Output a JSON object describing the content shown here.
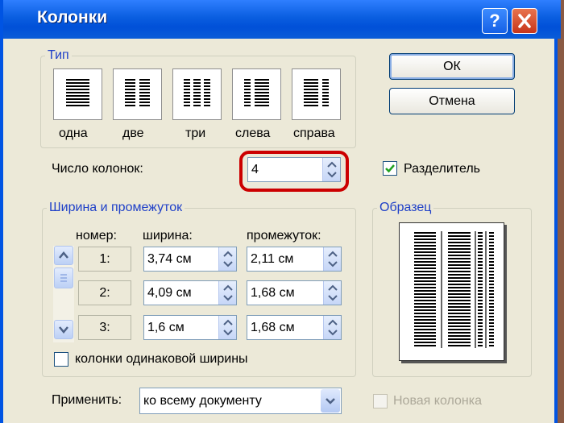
{
  "window": {
    "title": "Колонки",
    "help_symbol": "?",
    "close_symbol": "✕"
  },
  "type_group": {
    "legend": "Тип",
    "presets": [
      {
        "label": "одна",
        "icon": "one-column-icon"
      },
      {
        "label": "две",
        "icon": "two-columns-icon"
      },
      {
        "label": "три",
        "icon": "three-columns-icon"
      },
      {
        "label": "слева",
        "icon": "left-column-icon"
      },
      {
        "label": "справа",
        "icon": "right-column-icon"
      }
    ]
  },
  "buttons": {
    "ok": "ОК",
    "cancel": "Отмена"
  },
  "columns_count": {
    "label": "Число колонок:",
    "value": "4"
  },
  "separator": {
    "label": "Разделитель",
    "checked": true
  },
  "width_spacing": {
    "legend": "Ширина и промежуток",
    "headers": {
      "number": "номер:",
      "width": "ширина:",
      "spacing": "промежуток:"
    },
    "rows": [
      {
        "number": "1:",
        "width": "3,74 см",
        "spacing": "2,11 см"
      },
      {
        "number": "2:",
        "width": "4,09 см",
        "spacing": "1,68 см"
      },
      {
        "number": "3:",
        "width": "1,6 см",
        "spacing": "1,68 см"
      }
    ],
    "equal_width": {
      "label": "колонки одинаковой ширины",
      "checked": false
    }
  },
  "preview": {
    "legend": "Образец"
  },
  "apply": {
    "label": "Применить:",
    "value": "ко всему документу"
  },
  "new_column": {
    "label": "Новая колонка",
    "checked": false,
    "enabled": false
  },
  "colors": {
    "title_bar": "#0a5ee0",
    "dialog_bg": "#ece9d8",
    "highlight": "#cc0000",
    "group_legend": "#1f40c8"
  }
}
